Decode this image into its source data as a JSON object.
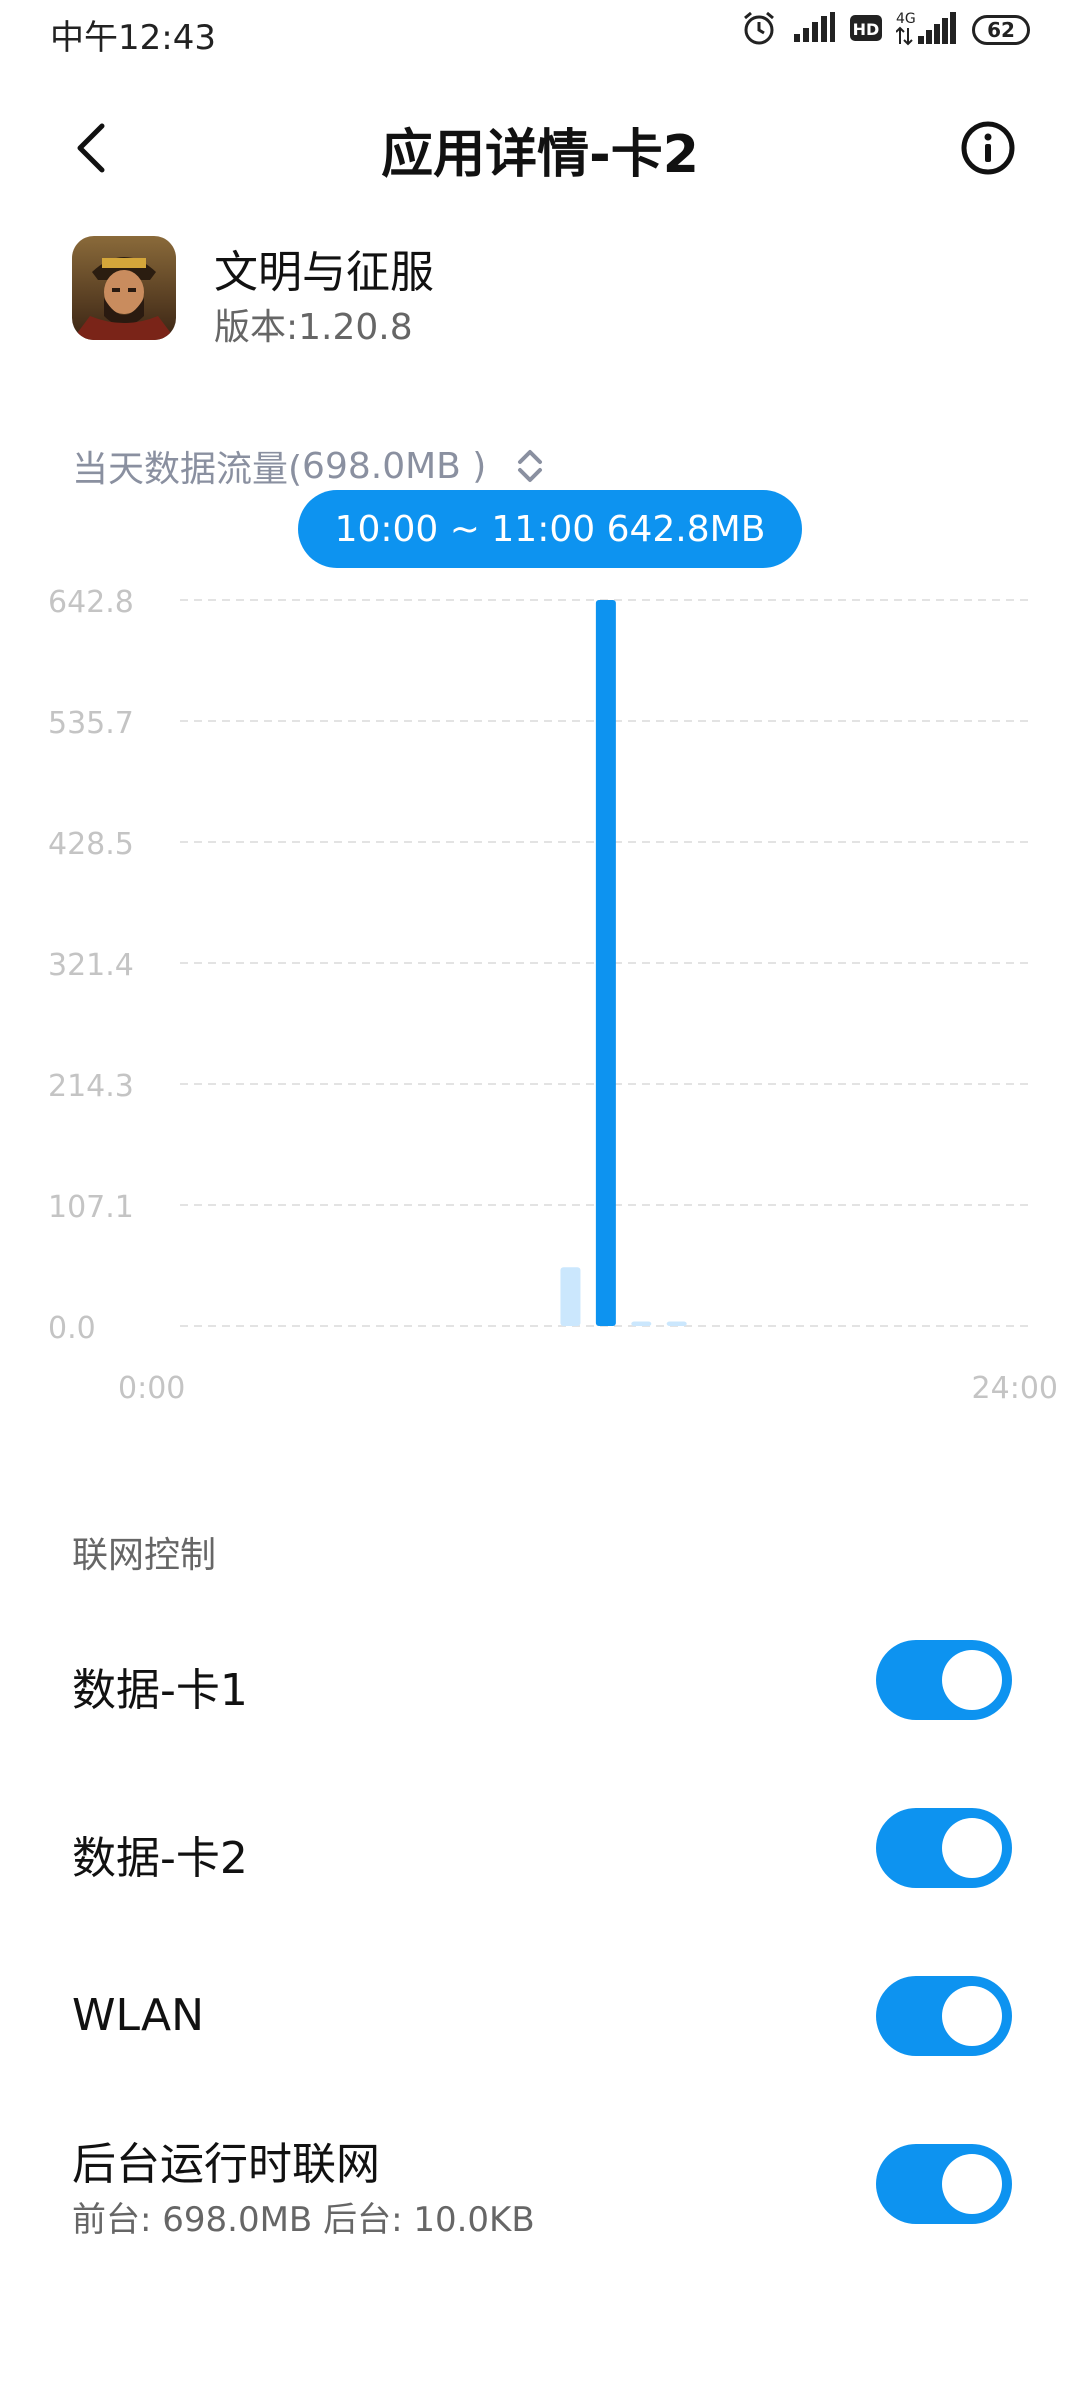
{
  "status_bar": {
    "time": "中午12:43",
    "icons": [
      "alarm-icon",
      "signal-icon",
      "hd-icon",
      "4g-signal-icon"
    ],
    "hd_label": "HD",
    "network_label": "4G",
    "battery": "62"
  },
  "header": {
    "title": "应用详情-卡2",
    "back_icon": "chevron-left-icon",
    "info_icon": "info-icon"
  },
  "app": {
    "name": "文明与征服",
    "version": "版本:1.20.8"
  },
  "usage": {
    "label": "当天数据流量(",
    "value": " 698.0MB )",
    "toggle_icon": "chevron-up-down-icon"
  },
  "tooltip": {
    "text": "10:00 ~ 11:00 642.8MB"
  },
  "colors": {
    "accent": "#0d93f0",
    "bar_light": "#cbe7fd",
    "grid": "#e3e3e3",
    "axis_text": "#c4c4c4"
  },
  "chart_data": {
    "type": "bar",
    "x_start_label": "0:00",
    "x_end_label": "24:00",
    "y_ticks": [
      "0.0",
      "107.1",
      "214.3",
      "321.4",
      "428.5",
      "535.7",
      "642.8"
    ],
    "ylim": [
      0,
      642.8
    ],
    "hours": [
      0,
      1,
      2,
      3,
      4,
      5,
      6,
      7,
      8,
      9,
      10,
      11,
      12,
      13,
      14,
      15,
      16,
      17,
      18,
      19,
      20,
      21,
      22,
      23
    ],
    "values": [
      0,
      0,
      0,
      0,
      0,
      0,
      0,
      0,
      0,
      52,
      642.8,
      4,
      4,
      0,
      0,
      0,
      0,
      0,
      0,
      0,
      0,
      0,
      0,
      0
    ],
    "selected_hour": 10
  },
  "network_control": {
    "title": "联网控制",
    "rows": [
      {
        "label": "数据-卡1",
        "on": true
      },
      {
        "label": "数据-卡2",
        "on": true
      },
      {
        "label": "WLAN",
        "on": true
      },
      {
        "label": "后台运行时联网",
        "sub": "前台: 698.0MB  后台: 10.0KB",
        "on": true
      }
    ]
  }
}
